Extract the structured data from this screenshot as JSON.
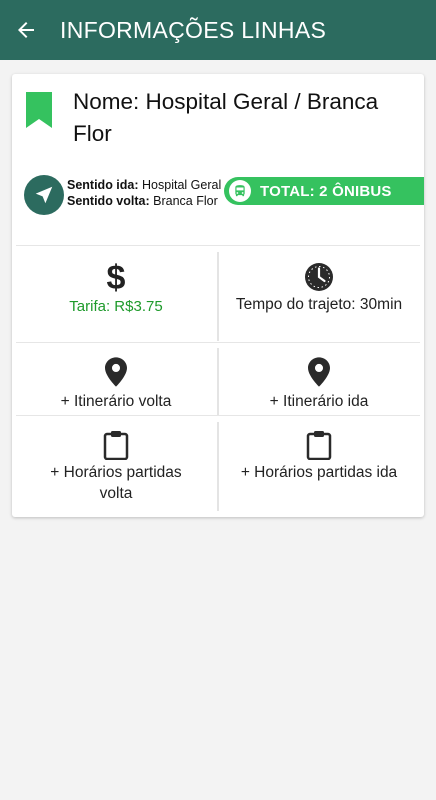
{
  "appbar": {
    "title": "INFORMAÇÕES LINHAS",
    "back_icon": "arrow-left-icon",
    "color": "#2c6b5f"
  },
  "line": {
    "name": "Nome: Hospital Geral / Branca Flor",
    "direction_ida_label": "Sentido ida:",
    "direction_ida_value": "Hospital Geral",
    "direction_volta_label": "Sentido volta:",
    "direction_volta_value": "Branca Flor",
    "total": "TOTAL: 2 ÔNIBUS",
    "total_color": "#35c25f"
  },
  "grid": {
    "tarifa": "Tarifa: R$3.75",
    "tempo": "Tempo do trajeto: 30min",
    "itinerario_volta": "+ Itinerário volta",
    "itinerario_ida": "+ Itinerário ida",
    "horarios_volta": "+ Horários partidas volta",
    "horarios_ida": "+ Horários partidas ida"
  }
}
